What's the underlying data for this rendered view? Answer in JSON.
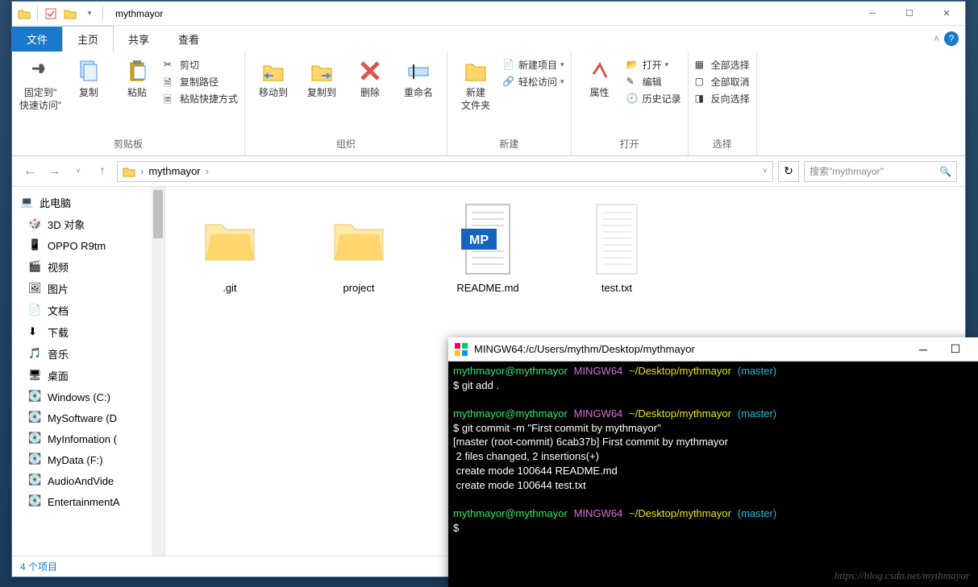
{
  "window": {
    "title": "mythmayor"
  },
  "tabs": {
    "file": "文件",
    "home": "主页",
    "share": "共享",
    "view": "查看"
  },
  "ribbon": {
    "clipboard": {
      "pin": "固定到\"\n快速访问\"",
      "copy": "复制",
      "paste": "粘贴",
      "cut": "剪切",
      "copypath": "复制路径",
      "pasteshortcut": "粘贴快捷方式",
      "label": "剪贴板"
    },
    "organize": {
      "moveto": "移动到",
      "copyto": "复制到",
      "delete": "删除",
      "rename": "重命名",
      "label": "组织"
    },
    "new": {
      "newfolder": "新建\n文件夹",
      "newitem": "新建项目",
      "easyaccess": "轻松访问",
      "label": "新建"
    },
    "open": {
      "properties": "属性",
      "open": "打开",
      "edit": "编辑",
      "history": "历史记录",
      "label": "打开"
    },
    "select": {
      "selectall": "全部选择",
      "selectnone": "全部取消",
      "invert": "反向选择",
      "label": "选择"
    }
  },
  "breadcrumb": {
    "item": "mythmayor"
  },
  "search": {
    "placeholder": "搜索\"mythmayor\""
  },
  "sidebar": {
    "thispc": "此电脑",
    "items": [
      "3D 对象",
      "OPPO R9tm",
      "视频",
      "图片",
      "文档",
      "下载",
      "音乐",
      "桌面",
      "Windows (C:)",
      "MySoftware (D",
      "MyInfomation (",
      "MyData (F:)",
      "AudioAndVide",
      "EntertainmentA"
    ]
  },
  "files": [
    ".git",
    "project",
    "README.md",
    "test.txt"
  ],
  "status": "4 个项目",
  "terminal": {
    "title": "MINGW64:/c/Users/mythm/Desktop/mythmayor",
    "prompt": {
      "user": "mythmayor@mythmayor",
      "env": "MINGW64",
      "path": "~/Desktop/mythmayor",
      "branch": "(master)"
    },
    "lines": {
      "l1": "$ git add .",
      "l2": "$ git commit -m \"First commit by mythmayor\"",
      "l3": "[master (root-commit) 6cab37b] First commit by mythmayor",
      "l4": " 2 files changed, 2 insertions(+)",
      "l5": " create mode 100644 README.md",
      "l6": " create mode 100644 test.txt",
      "l7": "$"
    },
    "watermark": "https://blog.csdn.net/mythmayor"
  }
}
